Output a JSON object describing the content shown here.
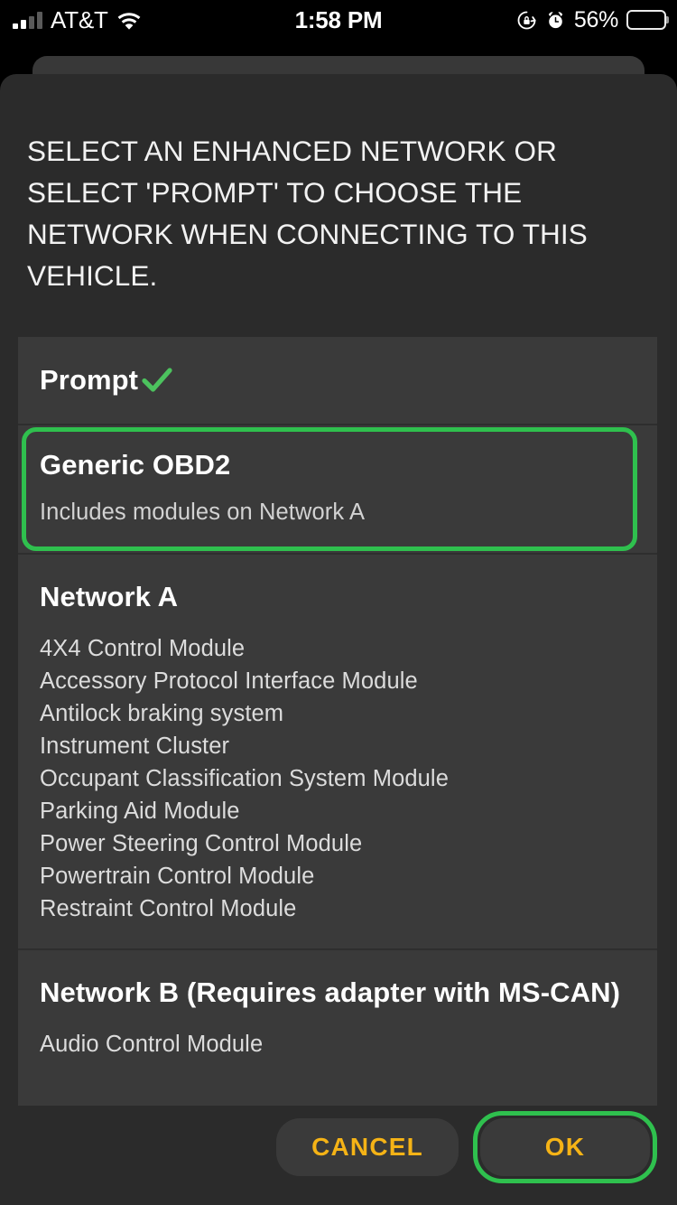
{
  "status_bar": {
    "carrier": "AT&T",
    "time": "1:58 PM",
    "battery_percent": "56%",
    "signal_icon": "cellular-signal-icon",
    "wifi_icon": "wifi-icon",
    "rotation_lock_icon": "rotation-lock-icon",
    "alarm_icon": "alarm-clock-icon",
    "battery_icon": "battery-icon",
    "signal_bars_active": 2,
    "signal_bars_total": 4,
    "battery_fill_ratio": 0.56
  },
  "dialog": {
    "title": "SELECT AN ENHANCED NETWORK OR SELECT 'PROMPT' TO CHOOSE THE NETWORK WHEN CONNECTING TO THIS VEHICLE.",
    "options": [
      {
        "label": "Prompt",
        "selected": true,
        "check_icon": "checkmark-icon"
      },
      {
        "label": "Generic OBD2",
        "subtitle": "Includes modules on Network A",
        "focused": true
      }
    ],
    "sections": [
      {
        "title": "Network A",
        "modules": [
          "4X4 Control Module",
          "Accessory Protocol Interface Module",
          "Antilock braking system",
          "Instrument Cluster",
          "Occupant Classification System Module",
          "Parking Aid Module",
          "Power Steering Control Module",
          "Powertrain Control Module",
          "Restraint Control Module"
        ]
      },
      {
        "title": "Network B (Requires adapter with MS-CAN)",
        "modules": [
          "Audio Control Module"
        ]
      }
    ],
    "buttons": {
      "cancel": "CANCEL",
      "ok": "OK"
    }
  },
  "colors": {
    "accent_green": "#2fc04e",
    "check_green": "#4cc25e",
    "button_text": "#f5b316",
    "dialog_bg": "#2b2b2b",
    "list_bg": "#3a3a3a",
    "backdrop_bg": "#383838"
  }
}
